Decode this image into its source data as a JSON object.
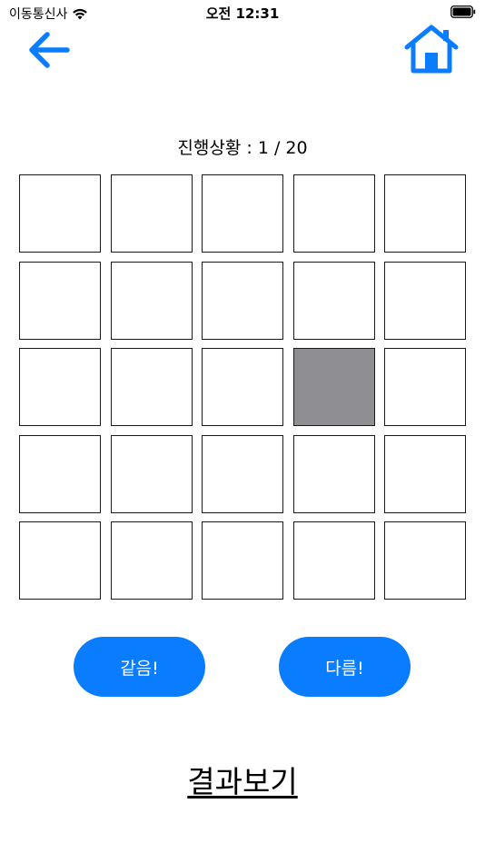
{
  "status_bar": {
    "carrier": "이동통신사",
    "time": "오전 12:31",
    "icons": [
      "wifi-icon",
      "battery-icon"
    ]
  },
  "nav": {
    "back_icon": "arrow-left-icon",
    "home_icon": "home-icon",
    "accent_color": "#0a7cff"
  },
  "progress": {
    "text": "진행상황 : 1 / 20",
    "current": 1,
    "total": 20
  },
  "grid": {
    "rows": 5,
    "cols": 5,
    "active_cell": {
      "row": 3,
      "col": 4
    },
    "active_color": "#8e8e93"
  },
  "buttons": {
    "same_label": "같음!",
    "different_label": "다름!"
  },
  "result_link": "결과보기"
}
